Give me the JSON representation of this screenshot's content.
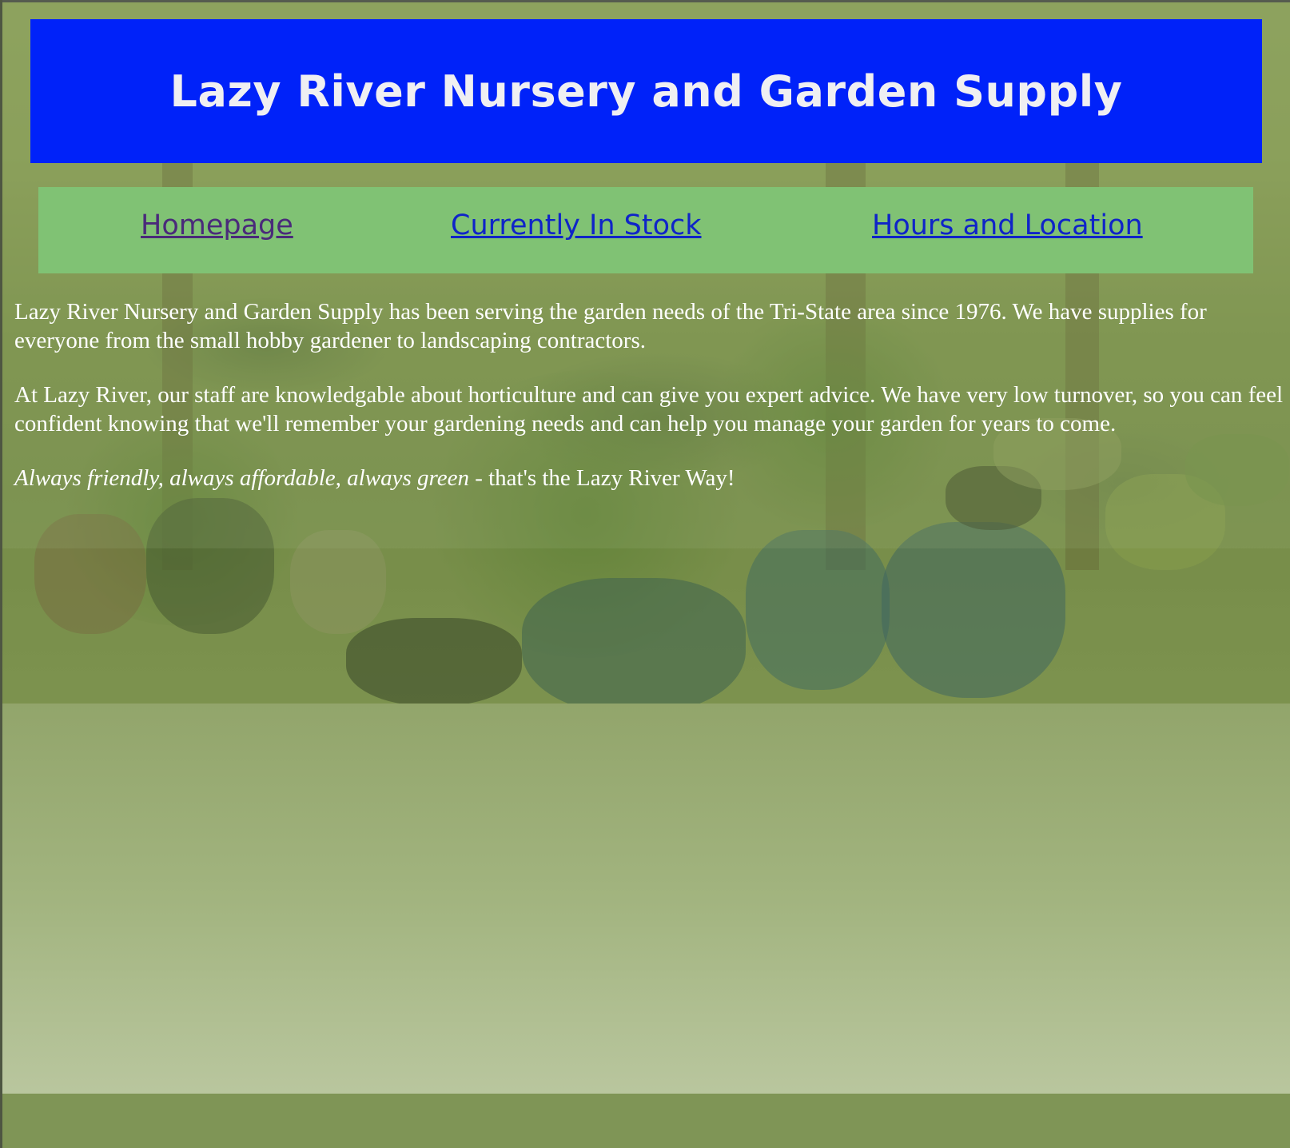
{
  "site": {
    "title": "Lazy River Nursery and Garden Supply"
  },
  "nav": {
    "items": [
      {
        "label": "Homepage",
        "state": "visited"
      },
      {
        "label": "Currently In Stock",
        "state": "link"
      },
      {
        "label": "Hours and Location",
        "state": "link"
      }
    ]
  },
  "content": {
    "paragraph_1": "Lazy River Nursery and Garden Supply has been serving the garden needs of the Tri-State area since 1976. We have supplies for everyone from the small hobby gardener to landscaping contractors.",
    "paragraph_2": "At Lazy River, our staff are knowledgable about horticulture and can give you expert advice. We have very low turnover, so you can feel confident knowing that we'll remember your gardening needs and can help you manage your garden for years to come.",
    "tagline_emphasis": "Always friendly, always affordable, always green",
    "tagline_rest": " - that's the Lazy River Way!"
  },
  "colors": {
    "header_bg": "#0022f9",
    "header_text": "#efeff2",
    "nav_bg": "#80c274",
    "link": "#0f24c8",
    "visited_link": "#4a2a7a",
    "body_text": "#ffffff",
    "page_bg": "#7f9556"
  },
  "background_image": {
    "subject": "garden-center-plants-and-pots"
  }
}
